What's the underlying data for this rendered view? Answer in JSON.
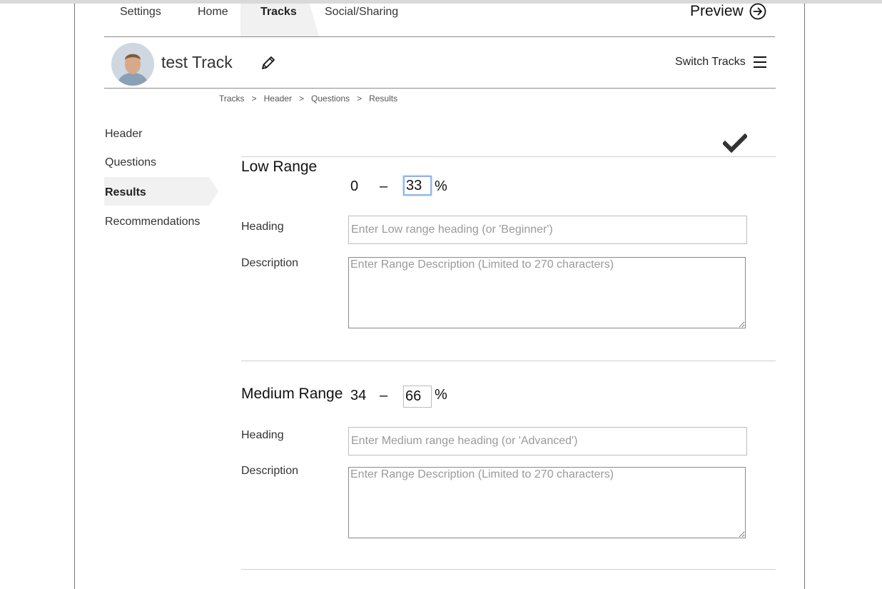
{
  "nav": {
    "tabs": [
      {
        "label": "Settings"
      },
      {
        "label": "Home"
      },
      {
        "label": "Tracks"
      },
      {
        "label": "Social/Sharing"
      }
    ],
    "active_tab": "Tracks",
    "preview_label": "Preview",
    "preview_icon": "arrow-right-circle-icon"
  },
  "track": {
    "title": "test Track",
    "edit_icon": "pencil-icon",
    "switch_label": "Switch Tracks",
    "switch_icon": "hamburger-menu-icon"
  },
  "breadcrumb": {
    "items": [
      "Tracks",
      "Header",
      "Questions",
      "Results"
    ],
    "separator": ">"
  },
  "sidebar": {
    "items": [
      {
        "label": "Header"
      },
      {
        "label": "Questions"
      },
      {
        "label": "Results"
      },
      {
        "label": "Recommendations"
      }
    ],
    "active_item": "Results"
  },
  "save_icon": "checkmark-icon",
  "ranges": [
    {
      "title": "Low Range",
      "min": "0",
      "dash": "–",
      "max": "33",
      "percent": "%",
      "heading_label": "Heading",
      "heading_placeholder": "Enter Low range heading (or 'Beginner')",
      "description_label": "Description",
      "description_placeholder": "Enter Range Description (Limited to 270 characters)"
    },
    {
      "title": "Medium Range",
      "min": "34",
      "dash": "–",
      "max": "66",
      "percent": "%",
      "heading_label": "Heading",
      "heading_placeholder": "Enter Medium range heading (or 'Advanced')",
      "description_label": "Description",
      "description_placeholder": "Enter Range Description (Limited to 270 characters)"
    }
  ]
}
